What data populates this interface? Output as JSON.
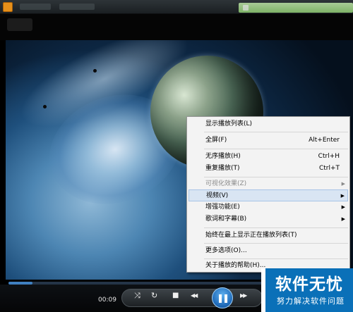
{
  "player": {
    "time_display": "00:09",
    "progress": 0.07,
    "icons": {
      "app": "player-app-icon",
      "repeat": "shuffle-icon",
      "refresh": "repeat-icon",
      "stop": "stop-icon",
      "prev": "rewind-icon",
      "play": "pause-icon",
      "next": "fast-forward-icon"
    },
    "control_labels": {
      "shuffle": "⤨",
      "repeat": "↻",
      "stop": "■",
      "prev": "◀◀",
      "pause": "❚❚",
      "next": "▶▶"
    }
  },
  "context_menu": {
    "items": [
      {
        "label": "显示播放列表(L)",
        "shortcut": ""
      },
      {
        "label": "全屏(F)",
        "shortcut": "Alt+Enter"
      },
      {
        "label": "无序播放(H)",
        "shortcut": "Ctrl+H"
      },
      {
        "label": "重复播放(T)",
        "shortcut": "Ctrl+T"
      },
      {
        "label": "可视化效果(Z)",
        "shortcut": "",
        "submenu": true,
        "disabled": true
      },
      {
        "label": "视频(V)",
        "shortcut": "",
        "submenu": true,
        "highlighted": true
      },
      {
        "label": "增强功能(E)",
        "shortcut": "",
        "submenu": true
      },
      {
        "label": "歌词和字幕(B)",
        "shortcut": "",
        "submenu": true
      },
      {
        "label": "始终在最上显示正在播放列表(T)",
        "shortcut": ""
      },
      {
        "label": "更多选项(O)...",
        "shortcut": ""
      },
      {
        "label": "关于播放的帮助(H)...",
        "shortcut": ""
      }
    ]
  },
  "watermark": {
    "main": "软件无忧",
    "sub": "努力解决软件问题"
  },
  "colors": {
    "menu_bg": "#f3f3f3",
    "highlight": "#d9e5f3",
    "accent": "#1c66b5"
  }
}
